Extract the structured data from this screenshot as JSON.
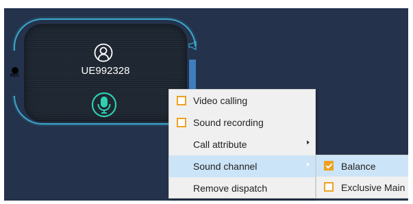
{
  "device": {
    "ue_id": "UE992328",
    "rec_label": "REC"
  },
  "context_menu": {
    "items": [
      {
        "label": "Video calling"
      },
      {
        "label": "Sound recording"
      },
      {
        "label": "Call attribute"
      },
      {
        "label": "Sound channel"
      },
      {
        "label": "Remove dispatch"
      }
    ]
  },
  "sound_channel_submenu": {
    "items": [
      {
        "label": "Balance",
        "checked": true
      },
      {
        "label": "Exclusive Main",
        "checked": false
      }
    ]
  },
  "colors": {
    "background": "#24324b",
    "accent_cyan": "#3aa8cc",
    "mic_green": "#2fd0b0",
    "checkbox_orange": "#f0a020",
    "menu_highlight": "#cce4f7",
    "volume_blue": "#3f7dc0"
  },
  "icons": {
    "user": "user-circle-icon",
    "mic": "microphone-icon",
    "speaker": "speaker-icon",
    "rec": "record-dot-icon"
  }
}
